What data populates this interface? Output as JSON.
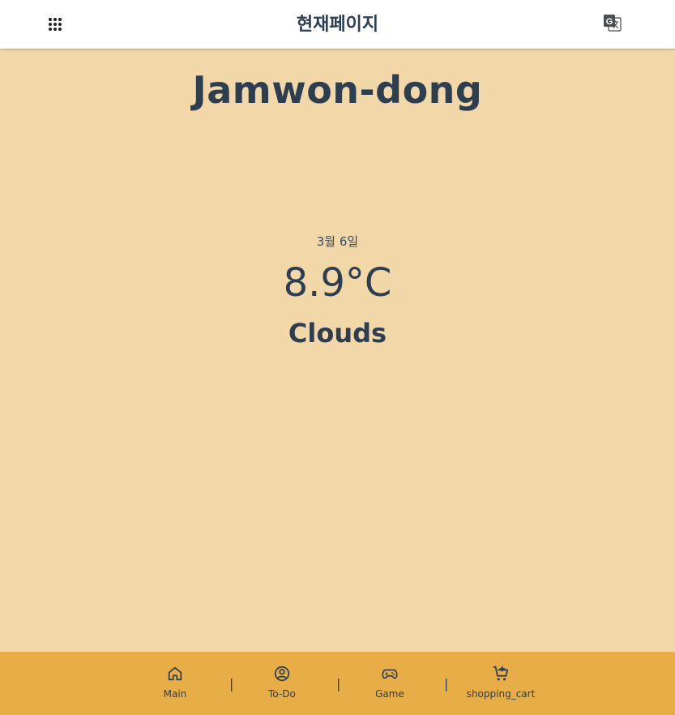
{
  "header": {
    "title": "현재페이지",
    "menu_icon": "apps-grid-icon",
    "translate_icon": "google-translate-icon"
  },
  "weather": {
    "city": "Jamwon-dong",
    "date": "3월 6일",
    "temperature": "8.9°C",
    "condition": "Clouds"
  },
  "footer": {
    "items": [
      {
        "label": "Main",
        "icon": "home-icon"
      },
      {
        "label": "To-Do",
        "icon": "user-circle-icon"
      },
      {
        "label": "Game",
        "icon": "gamepad-icon"
      },
      {
        "label": "shopping_cart",
        "icon": "add-shopping-cart-icon"
      }
    ],
    "separator": "|"
  },
  "colors": {
    "background": "#f2d8a8",
    "header": "#ffffff",
    "footer": "#e7ae47",
    "text": "#2c3e50"
  }
}
